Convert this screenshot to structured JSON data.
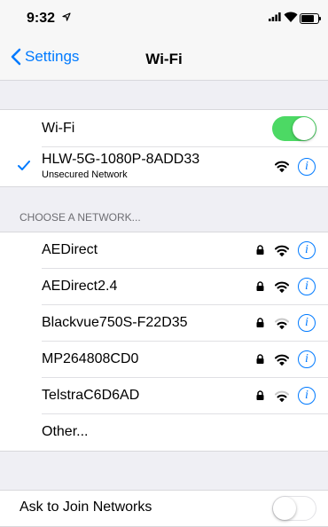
{
  "status": {
    "time": "9:32"
  },
  "nav": {
    "back_label": "Settings",
    "title": "Wi-Fi"
  },
  "wifi_toggle": {
    "label": "Wi-Fi",
    "on": true
  },
  "connected": {
    "name": "HLW-5G-1080P-8ADD33",
    "subtitle": "Unsecured Network"
  },
  "section": {
    "header": "CHOOSE A NETWORK..."
  },
  "networks": [
    {
      "name": "AEDirect",
      "locked": true,
      "signal": 3
    },
    {
      "name": "AEDirect2.4",
      "locked": true,
      "signal": 3
    },
    {
      "name": "Blackvue750S-F22D35",
      "locked": true,
      "signal": 2
    },
    {
      "name": "MP264808CD0",
      "locked": true,
      "signal": 3
    },
    {
      "name": "TelstraC6D6AD",
      "locked": true,
      "signal": 2
    }
  ],
  "other": {
    "label": "Other..."
  },
  "ask_to_join": {
    "label": "Ask to Join Networks",
    "on": false
  },
  "colors": {
    "accent": "#007aff",
    "toggle_on": "#4cd964",
    "background": "#efeff4"
  }
}
